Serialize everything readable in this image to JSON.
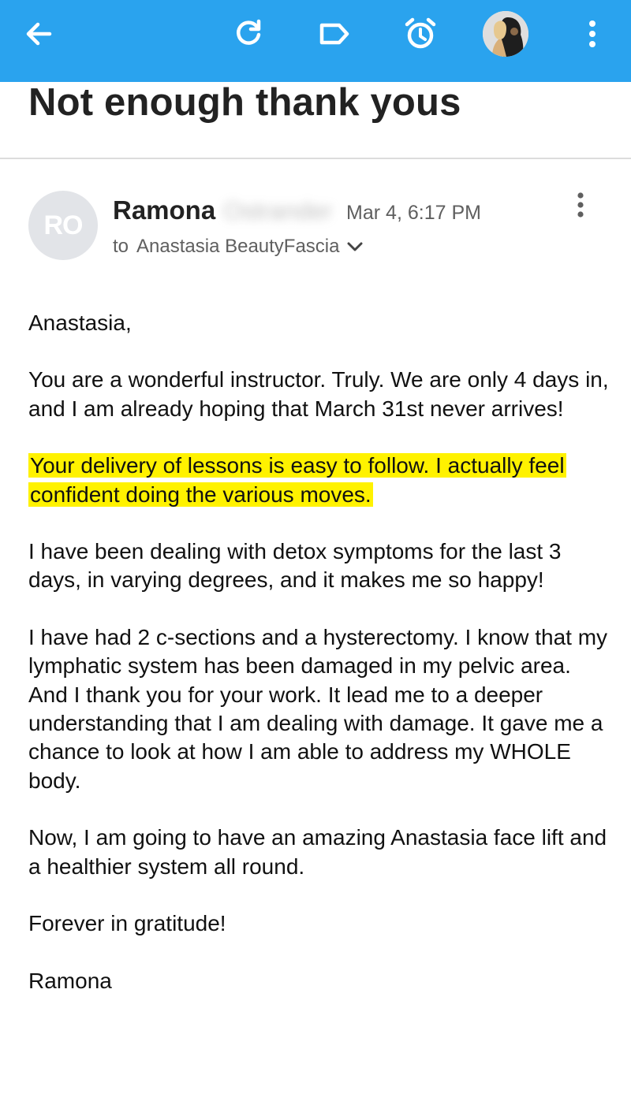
{
  "toolbar": {
    "background_color": "#2aa3ee",
    "icons": [
      "back-arrow-icon",
      "refresh-icon",
      "label-icon",
      "snooze-alarm-icon",
      "account-avatar",
      "more-vert-icon"
    ]
  },
  "email": {
    "subject": "Not enough thank yous",
    "sender": {
      "initials": "RO",
      "first_name": "Ramona",
      "last_name_blurred": "Ostrander"
    },
    "date": "Mar 4, 6:17 PM",
    "to_label": "to",
    "recipient": "Anastasia BeautyFascia",
    "highlight_color": "#fff200",
    "paragraphs": [
      "Anastasia,",
      "You are a wonderful instructor. Truly. We are only 4 days in, and I am already hoping that March 31st never arrives!",
      "Your delivery of lessons is easy to follow. I actually feel confident doing the various moves.",
      "I have been dealing with detox symptoms for the last 3 days, in varying degrees, and it makes me so happy!",
      "I have had 2 c-sections and a hysterectomy. I know that my lymphatic system has been damaged in my pelvic area. And I thank you for your work. It lead me to a deeper understanding that I am dealing with damage. It gave me a chance to look at how I am able to address my WHOLE body.",
      "Now, I am going to have an amazing Anastasia face lift and a healthier system all round.",
      "Forever in gratitude!",
      "Ramona"
    ]
  }
}
